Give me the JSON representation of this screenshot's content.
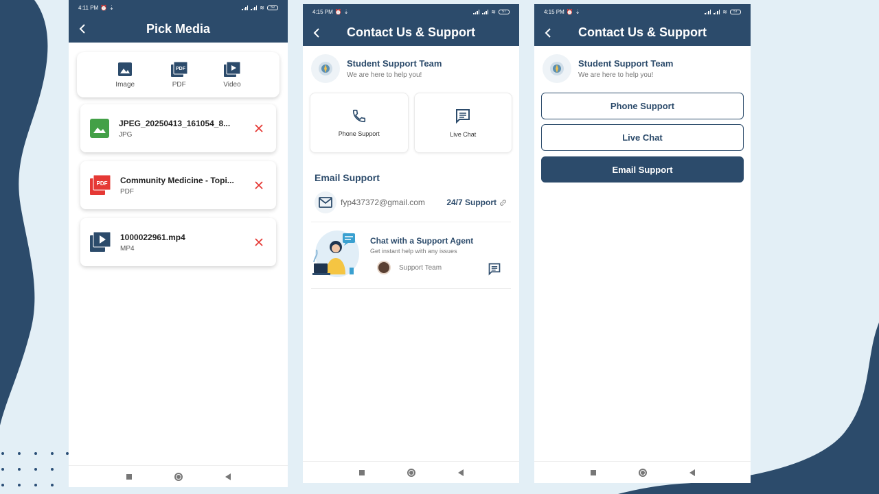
{
  "colors": {
    "primary": "#2c4b6b",
    "background": "#e3eff6",
    "remove": "#e53935",
    "image_icon": "#43a047",
    "pdf_icon": "#e53935"
  },
  "screen_pick_media": {
    "status_time": "4:11 PM",
    "battery": "59",
    "title": "Pick Media",
    "picker_options": [
      {
        "label": "Image",
        "icon": "image-icon"
      },
      {
        "label": "PDF",
        "icon": "pdf-icon"
      },
      {
        "label": "Video",
        "icon": "video-icon"
      }
    ],
    "files": [
      {
        "name": "JPEG_20250413_161054_8...",
        "type": "JPG",
        "icon": "image-file-icon"
      },
      {
        "name": "Community Medicine - Topi...",
        "type": "PDF",
        "icon": "pdf-file-icon"
      },
      {
        "name": "1000022961.mp4",
        "type": "MP4",
        "icon": "video-file-icon"
      }
    ]
  },
  "screen_contact": {
    "status_time": "4:15 PM",
    "battery": "57",
    "title": "Contact Us & Support",
    "team_name": "Student Support Team",
    "team_subtitle": "We are here to help you!",
    "options": [
      {
        "label": "Phone Support",
        "icon": "phone-icon"
      },
      {
        "label": "Live Chat",
        "icon": "chat-icon"
      }
    ],
    "email_section_title": "Email Support",
    "email_address": "fyp437372@gmail.com",
    "email_badge": "24/7 Support",
    "agent_title": "Chat with a Support Agent",
    "agent_subtitle": "Get instant help with any issues",
    "agent_team_label": "Support Team"
  },
  "screen_contact_buttons": {
    "status_time": "4:15 PM",
    "battery": "57",
    "title": "Contact Us & Support",
    "team_name": "Student Support Team",
    "team_subtitle": "We are here to help you!",
    "buttons": {
      "phone": "Phone Support",
      "live_chat": "Live Chat",
      "email": "Email Support"
    }
  }
}
